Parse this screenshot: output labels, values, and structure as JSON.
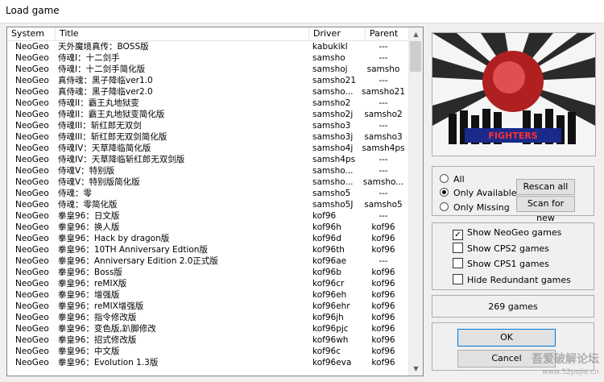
{
  "window": {
    "title": "Load game"
  },
  "list": {
    "headers": {
      "system": "System",
      "title": "Title",
      "driver": "Driver",
      "parent": "Parent"
    },
    "rows": [
      {
        "system": "NeoGeo",
        "title": "天外魔境真传：BOSS版",
        "driver": "kabukikl",
        "parent": "---"
      },
      {
        "system": "NeoGeo",
        "title": "侍魂I：十二剑手",
        "driver": "samsho",
        "parent": "---"
      },
      {
        "system": "NeoGeo",
        "title": "侍魂I：十二剑手简化版",
        "driver": "samshoj",
        "parent": "samsho"
      },
      {
        "system": "NeoGeo",
        "title": "真侍魂：黑子降临ver1.0",
        "driver": "samsho21",
        "parent": "---"
      },
      {
        "system": "NeoGeo",
        "title": "真侍魂：黑子降临ver2.0",
        "driver": "samsho...",
        "parent": "samsho21"
      },
      {
        "system": "NeoGeo",
        "title": "侍魂II：霸王丸地狱变",
        "driver": "samsho2",
        "parent": "---"
      },
      {
        "system": "NeoGeo",
        "title": "侍魂II：霸王丸地狱变简化版",
        "driver": "samsho2j",
        "parent": "samsho2"
      },
      {
        "system": "NeoGeo",
        "title": "侍魂III：斩红郎无双剑",
        "driver": "samsho3",
        "parent": "---"
      },
      {
        "system": "NeoGeo",
        "title": "侍魂III：斩红郎无双剑简化版",
        "driver": "samsho3j",
        "parent": "samsho3"
      },
      {
        "system": "NeoGeo",
        "title": "侍魂IV：天草降临简化版",
        "driver": "samsho4j",
        "parent": "samsh4ps"
      },
      {
        "system": "NeoGeo",
        "title": "侍魂IV：天草降临斩红郎无双剑版",
        "driver": "samsh4ps",
        "parent": "---"
      },
      {
        "system": "NeoGeo",
        "title": "侍魂V：特别版",
        "driver": "samsho...",
        "parent": "---"
      },
      {
        "system": "NeoGeo",
        "title": "侍魂V：特别版简化版",
        "driver": "samsho...",
        "parent": "samsho..."
      },
      {
        "system": "NeoGeo",
        "title": "侍魂：零",
        "driver": "samsho5",
        "parent": "---"
      },
      {
        "system": "NeoGeo",
        "title": "侍魂：零简化版",
        "driver": "samsho5J",
        "parent": "samsho5"
      },
      {
        "system": "NeoGeo",
        "title": "拳皇96：日文版",
        "driver": "kof96",
        "parent": "---"
      },
      {
        "system": "NeoGeo",
        "title": "拳皇96：换人版",
        "driver": "kof96h",
        "parent": "kof96"
      },
      {
        "system": "NeoGeo",
        "title": "拳皇96：Hack by dragon版",
        "driver": "kof96d",
        "parent": "kof96"
      },
      {
        "system": "NeoGeo",
        "title": "拳皇96：10TH Anniversary Edtion版",
        "driver": "kof96th",
        "parent": "kof96"
      },
      {
        "system": "NeoGeo",
        "title": "拳皇96：Anniversary Edition 2.0正式版",
        "driver": "kof96ae",
        "parent": "---"
      },
      {
        "system": "NeoGeo",
        "title": "拳皇96：Boss版",
        "driver": "kof96b",
        "parent": "kof96"
      },
      {
        "system": "NeoGeo",
        "title": "拳皇96：reMIX版",
        "driver": "kof96cr",
        "parent": "kof96"
      },
      {
        "system": "NeoGeo",
        "title": "拳皇96：增强版",
        "driver": "kof96eh",
        "parent": "kof96"
      },
      {
        "system": "NeoGeo",
        "title": "拳皇96：reMIX增强版",
        "driver": "kof96ehr",
        "parent": "kof96"
      },
      {
        "system": "NeoGeo",
        "title": "拳皇96：指令修改版",
        "driver": "kof96jh",
        "parent": "kof96"
      },
      {
        "system": "NeoGeo",
        "title": "拳皇96：变色版,趴脚修改",
        "driver": "kof96pjc",
        "parent": "kof96"
      },
      {
        "system": "NeoGeo",
        "title": "拳皇96：招式修改版",
        "driver": "kof96wh",
        "parent": "kof96"
      },
      {
        "system": "NeoGeo",
        "title": "拳皇96：中文版",
        "driver": "kof96c",
        "parent": "kof96"
      },
      {
        "system": "NeoGeo",
        "title": "拳皇96：Evolution 1.3版",
        "driver": "kof96eva",
        "parent": "kof96"
      }
    ]
  },
  "filters": {
    "all": "All",
    "only_available": "Only Available",
    "only_missing": "Only Missing",
    "selected": "only_available"
  },
  "buttons": {
    "rescan": "Rescan all",
    "scan_new": "Scan for new",
    "ok": "OK",
    "cancel": "Cancel"
  },
  "options": [
    {
      "label": "Show NeoGeo games",
      "checked": true
    },
    {
      "label": "Show CPS2 games",
      "checked": false
    },
    {
      "label": "Show CPS1 games",
      "checked": false
    },
    {
      "label": "Hide Redundant games",
      "checked": false
    }
  ],
  "status": {
    "count": "269 games"
  },
  "watermark": {
    "main": "吾爱破解论坛",
    "sub": "www.52pojie.cn"
  },
  "preview": {
    "logo": "FIGHTERS"
  }
}
